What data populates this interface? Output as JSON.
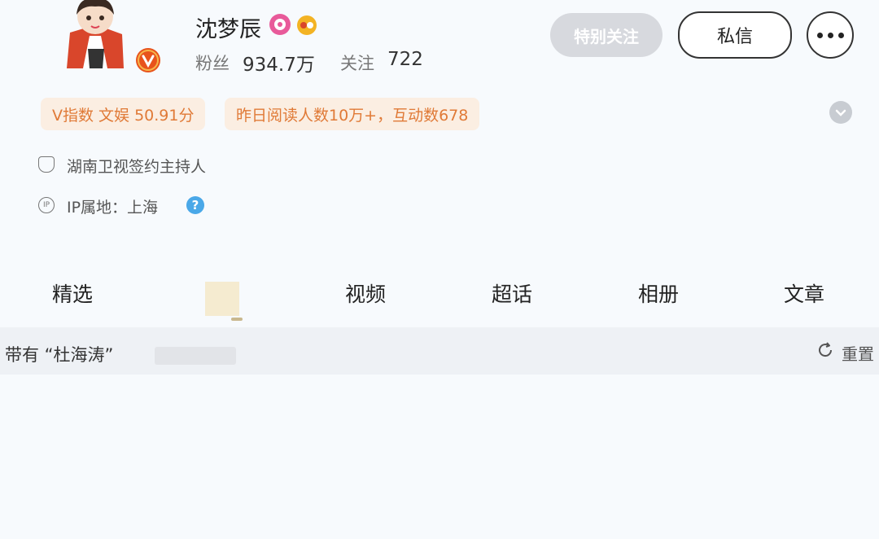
{
  "profile": {
    "name": "沈梦辰",
    "fans_label": "粉丝",
    "fans_value": "934.7万",
    "follow_label": "关注",
    "follow_value": "722"
  },
  "actions": {
    "special_follow_label": "特别关注",
    "dm_label": "私信"
  },
  "stats": {
    "vindex": "V指数 文娱 50.91分",
    "daily": "昨日阅读人数10万+，互动数678"
  },
  "info": {
    "line1": "湖南卫视签约主持人",
    "line2": "IP属地：上海",
    "ip_icon_text": "IP",
    "help_glyph": "?"
  },
  "tabs": [
    "精选",
    "视频",
    "超话",
    "相册",
    "文章"
  ],
  "filter": {
    "text": "带有 “杜海涛”",
    "reset_label": "重置"
  },
  "colors": {
    "accent_orange": "#e07a37",
    "stat_bg": "#fbeee2",
    "verified": "#e8531c",
    "badge_pink": "#e85a9a",
    "badge_gold": "#f3b324",
    "help_blue": "#4aa8e8"
  }
}
